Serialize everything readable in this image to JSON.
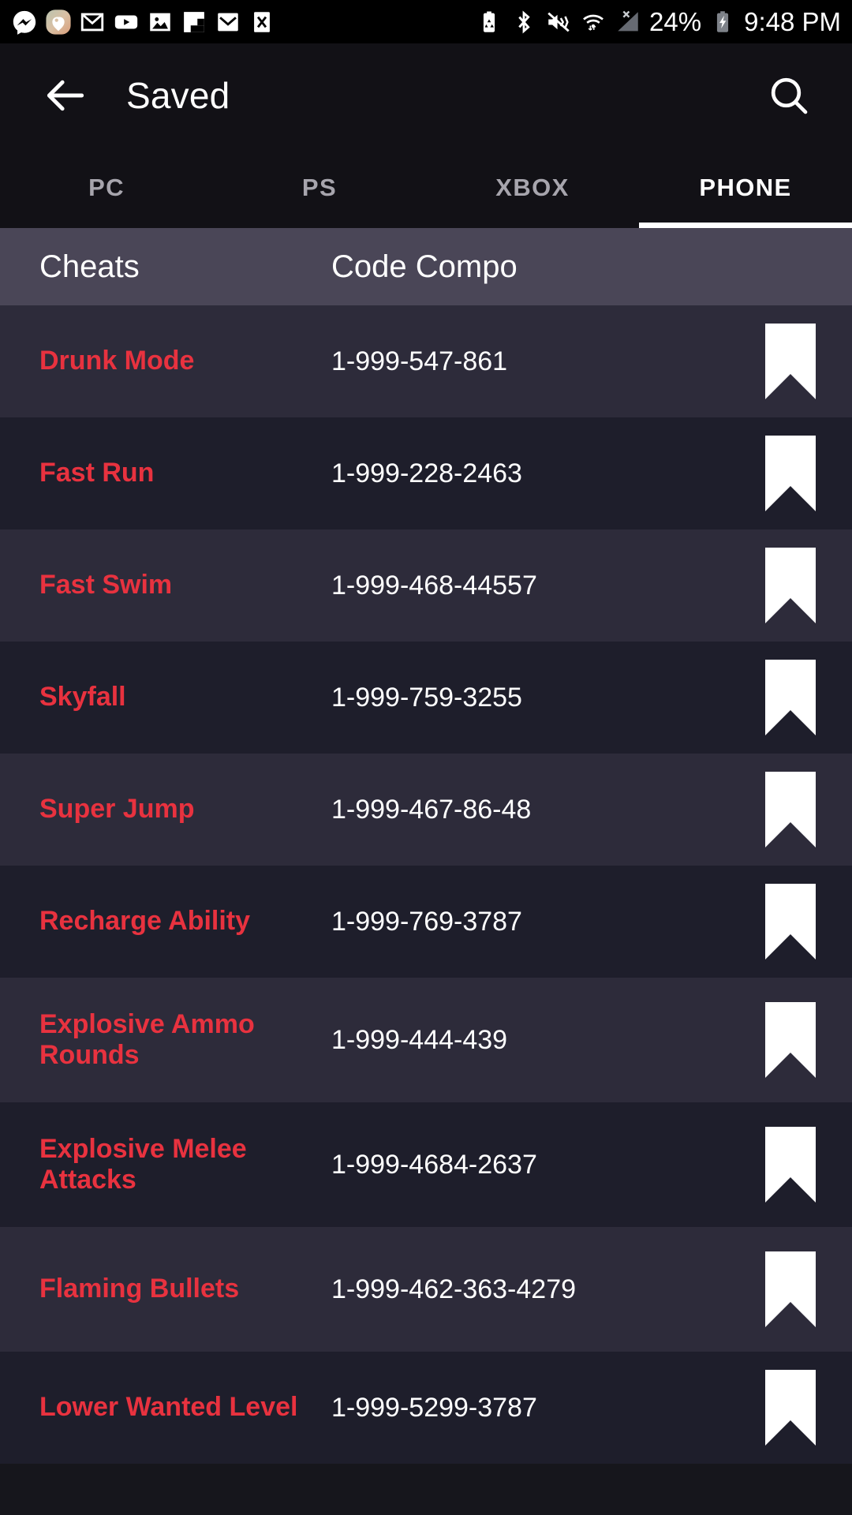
{
  "status_bar": {
    "notification_icons": [
      {
        "name": "messenger-icon"
      },
      {
        "name": "heart-location-icon"
      },
      {
        "name": "gmail-icon"
      },
      {
        "name": "youtube-icon"
      },
      {
        "name": "photos-icon"
      },
      {
        "name": "flipboard-icon"
      },
      {
        "name": "mail-icon"
      },
      {
        "name": "close-x-icon"
      }
    ],
    "system_icons": [
      {
        "name": "battery-saver-icon"
      },
      {
        "name": "bluetooth-icon"
      },
      {
        "name": "volume-mute-vibrate-icon"
      },
      {
        "name": "wifi-icon"
      },
      {
        "name": "cellular-no-signal-icon"
      }
    ],
    "battery_percent": "24%",
    "battery_state_icon": "battery-charging-icon",
    "clock": "9:48 PM"
  },
  "app_bar": {
    "back_icon": "arrow-back-icon",
    "title": "Saved",
    "search_icon": "search-icon"
  },
  "tabs": [
    {
      "label": "PC",
      "active": false
    },
    {
      "label": "PS",
      "active": false
    },
    {
      "label": "XBOX",
      "active": false
    },
    {
      "label": "PHONE",
      "active": true
    }
  ],
  "table": {
    "headers": {
      "cheats": "Cheats",
      "code": "Code Compo"
    },
    "rows": [
      {
        "name": "Drunk Mode",
        "code": "1-999-547-861",
        "bookmark_icon": "bookmark-icon"
      },
      {
        "name": "Fast Run",
        "code": "1-999-228-2463",
        "bookmark_icon": "bookmark-icon"
      },
      {
        "name": "Fast Swim",
        "code": "1-999-468-44557",
        "bookmark_icon": "bookmark-icon"
      },
      {
        "name": "Skyfall",
        "code": "1-999-759-3255",
        "bookmark_icon": "bookmark-icon"
      },
      {
        "name": "Super Jump",
        "code": "1-999-467-86-48",
        "bookmark_icon": "bookmark-icon"
      },
      {
        "name": "Recharge Ability",
        "code": "1-999-769-3787",
        "bookmark_icon": "bookmark-icon"
      },
      {
        "name": "Explosive Ammo Rounds",
        "code": "1-999-444-439",
        "bookmark_icon": "bookmark-icon"
      },
      {
        "name": "Explosive Melee Attacks",
        "code": "1-999-4684-2637",
        "bookmark_icon": "bookmark-icon"
      },
      {
        "name": "Flaming Bullets",
        "code": "1-999-462-363-4279",
        "bookmark_icon": "bookmark-icon"
      },
      {
        "name": "Lower Wanted Level",
        "code": "1-999-5299-3787",
        "bookmark_icon": "bookmark-icon"
      }
    ]
  },
  "colors": {
    "accent_red": "#e8323f",
    "header_purple": "#4a4657",
    "row_light": "#2d2b3a",
    "row_dark": "#1e1e2b",
    "appbar_bg": "#121116",
    "statusbar_bg": "#000000"
  }
}
